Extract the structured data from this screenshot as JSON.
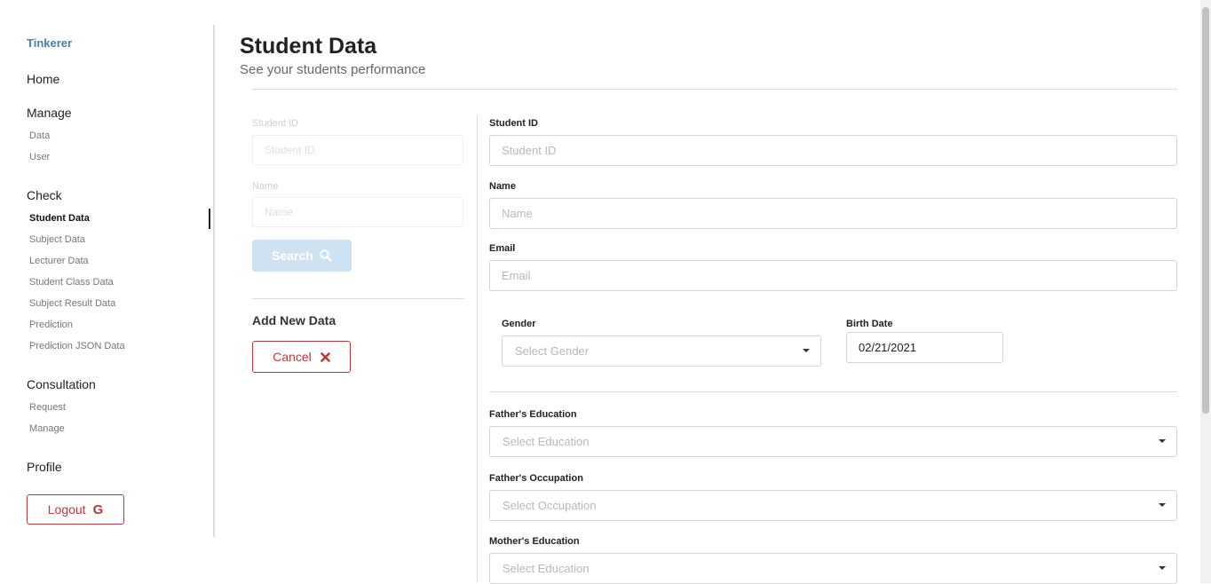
{
  "sidebar": {
    "brand": "Tinkerer",
    "home": "Home",
    "manage": {
      "title": "Manage",
      "items": [
        "Data",
        "User"
      ]
    },
    "check": {
      "title": "Check",
      "items": [
        "Student Data",
        "Subject Data",
        "Lecturer Data",
        "Student Class Data",
        "Subject Result Data",
        "Prediction",
        "Prediction JSON Data"
      ]
    },
    "consultation": {
      "title": "Consultation",
      "items": [
        "Request",
        "Manage"
      ]
    },
    "profile": "Profile",
    "logout": {
      "label": "Logout",
      "icon": "google-icon",
      "glyph": "G"
    }
  },
  "header": {
    "title": "Student Data",
    "subtitle": "See your students performance"
  },
  "search_panel": {
    "student_id_label": "Student ID",
    "student_id_placeholder": "Student ID",
    "name_label": "Name",
    "name_placeholder": "Name",
    "search_button": "Search",
    "add_new_title": "Add New Data",
    "cancel_button": "Cancel"
  },
  "form": {
    "student_id": {
      "label": "Student ID",
      "placeholder": "Student ID"
    },
    "name": {
      "label": "Name",
      "placeholder": "Name"
    },
    "email": {
      "label": "Email",
      "placeholder": "Email"
    },
    "gender": {
      "label": "Gender",
      "placeholder": "Select Gender"
    },
    "birth_date": {
      "label": "Birth Date",
      "value": "02/21/2021"
    },
    "fathers_education": {
      "label": "Father's Education",
      "placeholder": "Select Education"
    },
    "fathers_occupation": {
      "label": "Father's Occupation",
      "placeholder": "Select Occupation"
    },
    "mothers_education": {
      "label": "Mother's Education",
      "placeholder": "Select Education"
    }
  },
  "colors": {
    "brand": "#4a7ea8",
    "danger": "#b93a3a",
    "search_button_bg": "#cfe2f3"
  }
}
